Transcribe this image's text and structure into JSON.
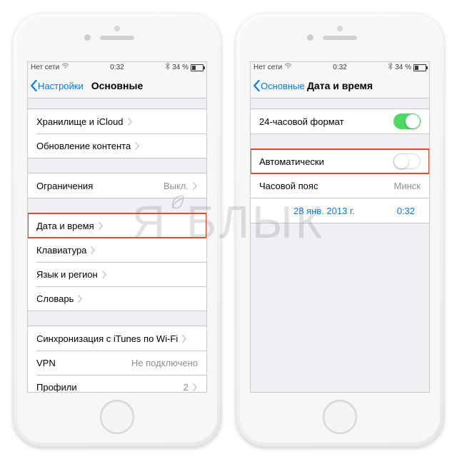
{
  "watermark": "ЯБЛЫК",
  "status": {
    "carrier": "Нет сети",
    "wifi_icon": "wifi",
    "time": "0:32",
    "bt_icon": "bluetooth",
    "battery_text": "34 %",
    "battery_level": 34
  },
  "left": {
    "back_label": "Настройки",
    "title": "Основные",
    "group1": [
      {
        "label": "Хранилище и iCloud",
        "detail": "",
        "chev": true
      },
      {
        "label": "Обновление контента",
        "detail": "",
        "chev": true
      }
    ],
    "group2": [
      {
        "label": "Ограничения",
        "detail": "Выкл.",
        "chev": true
      }
    ],
    "group3": [
      {
        "label": "Дата и время",
        "detail": "",
        "chev": true,
        "highlight": true
      },
      {
        "label": "Клавиатура",
        "detail": "",
        "chev": true
      },
      {
        "label": "Язык и регион",
        "detail": "",
        "chev": true
      },
      {
        "label": "Словарь",
        "detail": "",
        "chev": true
      }
    ],
    "group4": [
      {
        "label": "Синхронизация с iTunes по Wi-Fi",
        "detail": "",
        "chev": true
      },
      {
        "label": "VPN",
        "detail": "Не подключено",
        "chev": false
      },
      {
        "label": "Профили",
        "detail": "2",
        "chev": true
      }
    ]
  },
  "right": {
    "back_label": "Основные",
    "title": "Дата и время",
    "row_24h": {
      "label": "24-часовой формат",
      "on": true
    },
    "row_auto": {
      "label": "Автоматически",
      "on": false,
      "highlight": true
    },
    "row_tz": {
      "label": "Часовой пояс",
      "detail": "Минск"
    },
    "row_date": {
      "date": "28 янв. 2013 г.",
      "time": "0:32"
    }
  }
}
